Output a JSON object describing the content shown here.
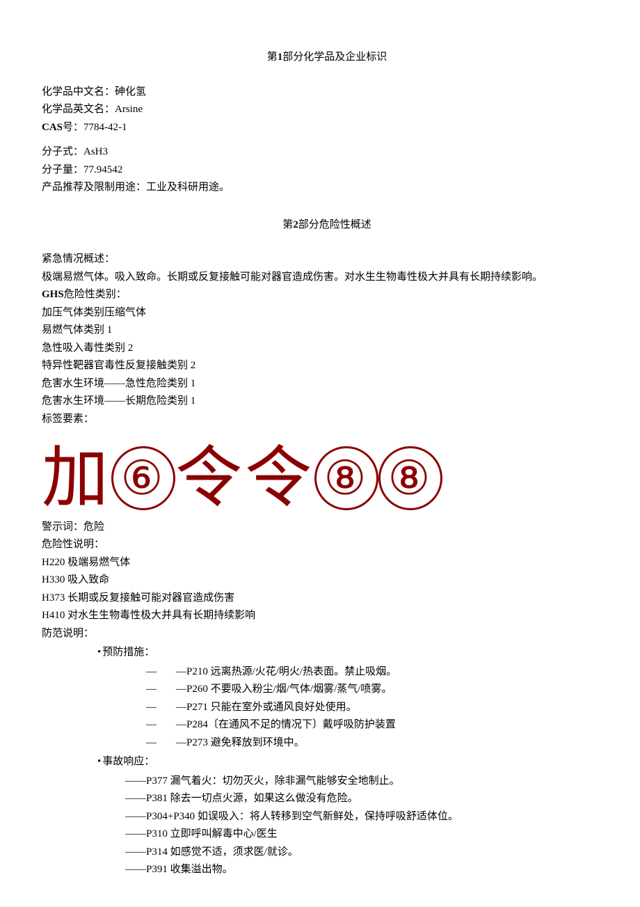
{
  "section1": {
    "title_prefix": "第",
    "title_num": "1",
    "title_suffix": "部分化学品及企业标识",
    "fields": {
      "name_cn_label": "化学品中文名：",
      "name_cn_value": "砷化氢",
      "name_en_label": "化学品英文名：",
      "name_en_value": "Arsine",
      "cas_label": "CAS",
      "cas_sep": "号：",
      "cas_value": "7784-42-1",
      "formula_label": "分子式：",
      "formula_value": "AsH3",
      "weight_label": "分子量：",
      "weight_value": "77.94542",
      "use_label": "产品推荐及限制用途：",
      "use_value": "工业及科研用途。"
    }
  },
  "section2": {
    "title_prefix": "第",
    "title_num": "2",
    "title_suffix": "部分危险性概述",
    "emergency_label": "紧急情况概述：",
    "emergency_text": "极端易燃气体。吸入致命。长期或反复接触可能对器官造成伤害。对水生生物毒性极大并具有长期持续影响。",
    "ghs_label": "GHS",
    "ghs_label_cn": "危险性类别：",
    "ghs_categories": [
      "加压气体类别压缩气体",
      "易燃气体类别 1",
      "急性吸入毒性类别 2",
      "特异性靶器官毒性反复接触类别 2",
      "危害水生环境——急性危险类别 1",
      "危害水生环境——长期危险类别 1"
    ],
    "label_elements": "标签要素：",
    "pictograms": [
      "加",
      "⑥",
      "令",
      "令",
      "⑧",
      "⑧"
    ],
    "signal_label": "警示词：",
    "signal_value": "危险",
    "hazard_label": "危险性说明：",
    "hazard_statements": [
      "H220 极端易燃气体",
      "H330 吸入致命",
      "H373 长期或反复接触可能对器官造成伤害",
      "H410 对水生生物毒性极大并具有长期持续影响"
    ],
    "precaution_label": "防范说明：",
    "prevention_label": "预防措施：",
    "prevention_items": [
      "—P210 远离热源/火花/明火/热表面。禁止吸烟。",
      "—P260 不要吸入粉尘/烟/气体/烟雾/蒸气/喷雾。",
      "—P271 只能在室外或通风良好处使用。",
      "—P284〔在通风不足的情况下〕戴呼吸防护装置",
      "—P273 避免释放到环境中。"
    ],
    "response_label": "事故响应：",
    "response_items": [
      "——P377 漏气着火：切勿灭火，除非漏气能够安全地制止。",
      "——P381 除去一切点火源，如果这么做没有危险。",
      "——P304+P340 如误吸入：将人转移到空气新鲜处，保持呼吸舒适体位。",
      "——P310 立即呼叫解毒中心/医生",
      "——P314 如感觉不适，须求医/就诊。",
      "——P391 收集溢出物。"
    ]
  }
}
